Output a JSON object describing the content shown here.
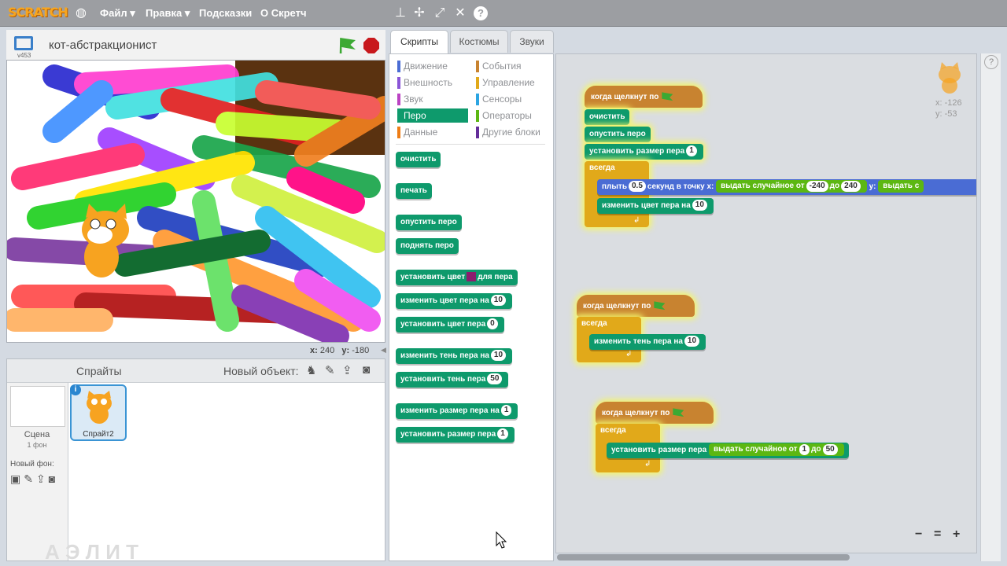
{
  "topbar": {
    "logo": "SCRATCH",
    "menu": [
      "Файл",
      "Правка",
      "Подсказки",
      "О Скретч"
    ],
    "icons": [
      "globe-icon",
      "stamp-icon",
      "move-icon",
      "grow-icon",
      "shrink-icon",
      "help-icon"
    ]
  },
  "stage": {
    "title": "кот-абстракционист",
    "version": "v453",
    "coords_x_label": "x:",
    "coords_x": "240",
    "coords_y_label": "y:",
    "coords_y": "-180"
  },
  "sprites": {
    "header": "Спрайты",
    "new_object": "Новый объект:",
    "scene_label": "Сцена",
    "scene_bg": "1 фон",
    "new_bg": "Новый фон:",
    "sprite_name": "Спрайт2",
    "watermark": "А Э Л И Т"
  },
  "tabs": [
    "Скрипты",
    "Костюмы",
    "Звуки"
  ],
  "categories_left": [
    {
      "label": "Движение",
      "color": "#4a6cd4"
    },
    {
      "label": "Внешность",
      "color": "#8a55d7"
    },
    {
      "label": "Звук",
      "color": "#bb42c3"
    },
    {
      "label": "Перо",
      "color": "#0e9a6c"
    },
    {
      "label": "Данные",
      "color": "#ee7d16"
    }
  ],
  "categories_right": [
    {
      "label": "События",
      "color": "#c88330"
    },
    {
      "label": "Управление",
      "color": "#e1a91a"
    },
    {
      "label": "Сенсоры",
      "color": "#2ca5e2"
    },
    {
      "label": "Операторы",
      "color": "#5cb712"
    },
    {
      "label": "Другие блоки",
      "color": "#632d99"
    }
  ],
  "palette_blocks": {
    "clear": "очистить",
    "stamp": "печать",
    "pen_down": "опустить перо",
    "pen_up": "поднять перо",
    "set_color_a": "установить цвет",
    "set_color_b": "для пера",
    "change_color": "изменить цвет пера на",
    "change_color_val": "10",
    "set_color_to": "установить цвет пера",
    "set_color_to_val": "0",
    "change_shade": "изменить тень пера на",
    "change_shade_val": "10",
    "set_shade": "установить тень пера",
    "set_shade_val": "50",
    "change_size": "изменить размер пера на",
    "change_size_val": "1",
    "set_size": "установить размер пера",
    "set_size_val": "1"
  },
  "script1": {
    "hat": "когда щелкнут по",
    "clear": "очистить",
    "pen_down": "опустить перо",
    "set_size": "установить размер пера",
    "set_size_val": "1",
    "forever": "всегда",
    "glide": "плыть",
    "glide_secs": "0.5",
    "glide_mid": "секунд в точку x:",
    "random": "выдать случайное от",
    "from": "-240",
    "to_word": "до",
    "to": "240",
    "y_label": "y:",
    "random2": "выдать с",
    "change_color": "изменить цвет пера на",
    "change_color_val": "10"
  },
  "script2": {
    "hat": "когда щелкнут по",
    "forever": "всегда",
    "change_shade": "изменить тень пера на",
    "change_shade_val": "10"
  },
  "script3": {
    "hat": "когда щелкнут по",
    "forever": "всегда",
    "set_size": "установить размер пера",
    "random": "выдать случайное от",
    "from": "1",
    "to_word": "до",
    "to": "50"
  },
  "sprite_info": {
    "x_label": "x:",
    "x": "-126",
    "y_label": "y:",
    "y": "-53"
  },
  "zoom": {
    "out": "−",
    "reset": "=",
    "in": "+"
  }
}
